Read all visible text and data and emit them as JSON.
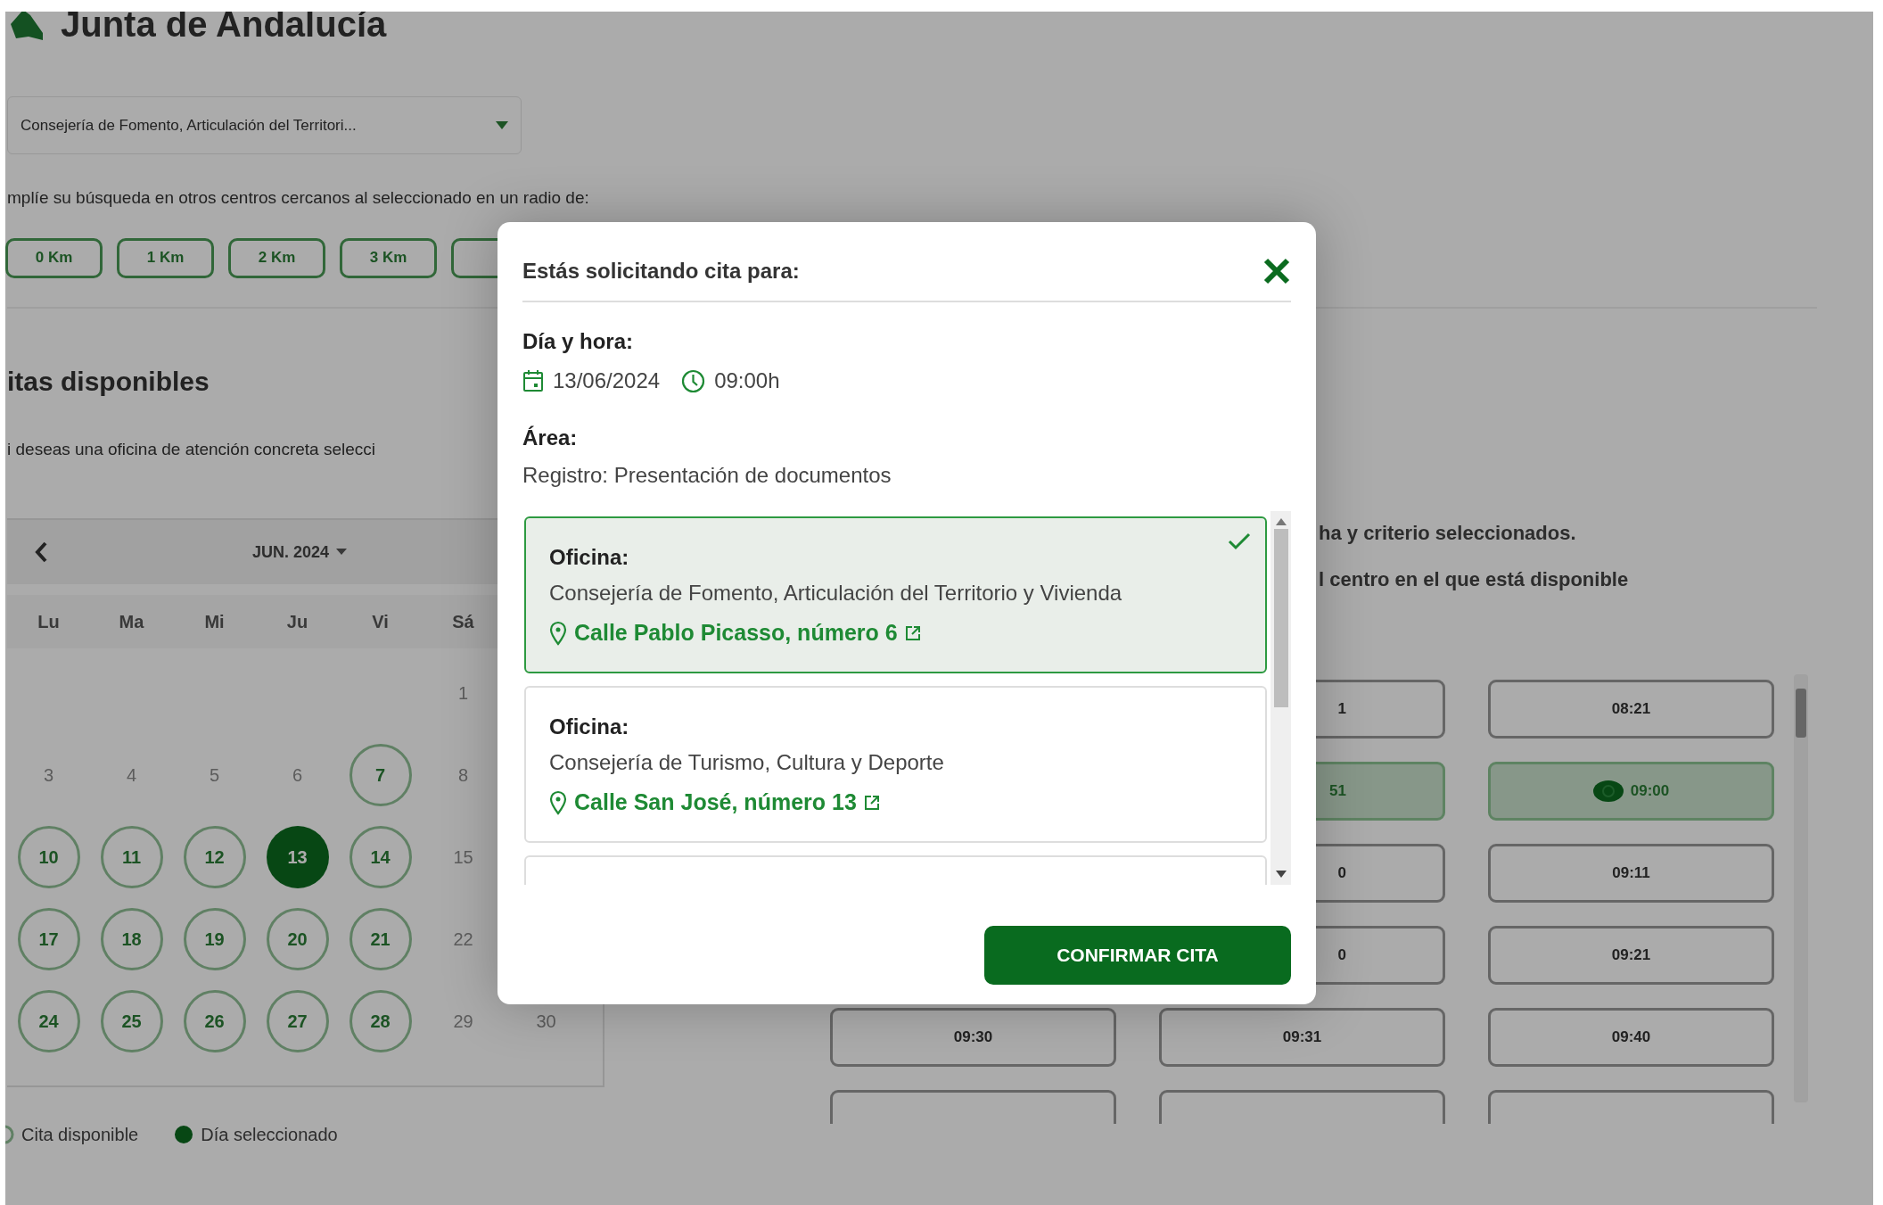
{
  "header": {
    "title": "Junta de Andalucía"
  },
  "office_select": {
    "value": "Consejería de Fomento, Articulación del Territori..."
  },
  "radius_prompt": "mplíe su búsqueda en otros centros cercanos al seleccionado en un radio de:",
  "radius_options": [
    {
      "label": "0 Km",
      "selected": false
    },
    {
      "label": "1 Km",
      "selected": false
    },
    {
      "label": "2 Km",
      "selected": false
    },
    {
      "label": "3 Km",
      "selected": false
    },
    {
      "selected": false
    }
  ],
  "section_title": "itas disponibles",
  "section_hint": "i deseas una oficina de atención concreta selecci",
  "results_notes": [
    "ha y criterio seleccionados.",
    "l centro en el que está disponible"
  ],
  "calendar": {
    "month": "JUN. 2024",
    "weekdays": [
      "Lu",
      "Ma",
      "Mi",
      "Ju",
      "Vi",
      "Sá"
    ],
    "weeks": [
      [
        {
          "day": "1",
          "available": false,
          "selected": false
        }
      ],
      [
        {
          "day": "3",
          "available": false,
          "selected": false
        },
        {
          "day": "4",
          "available": false,
          "selected": false
        },
        {
          "day": "5",
          "available": false,
          "selected": false
        },
        {
          "day": "6",
          "available": false,
          "selected": false
        },
        {
          "day": "7",
          "available": true,
          "selected": false
        },
        {
          "day": "8",
          "available": false,
          "selected": false
        }
      ],
      [
        {
          "day": "10",
          "available": true,
          "selected": false
        },
        {
          "day": "11",
          "available": true,
          "selected": false
        },
        {
          "day": "12",
          "available": true,
          "selected": false
        },
        {
          "day": "13",
          "available": true,
          "selected": true
        },
        {
          "day": "14",
          "available": true,
          "selected": false
        },
        {
          "day": "15",
          "available": false,
          "selected": false
        }
      ],
      [
        {
          "day": "17",
          "available": true,
          "selected": false
        },
        {
          "day": "18",
          "available": true,
          "selected": false
        },
        {
          "day": "19",
          "available": true,
          "selected": false
        },
        {
          "day": "20",
          "available": true,
          "selected": false
        },
        {
          "day": "21",
          "available": true,
          "selected": false
        },
        {
          "day": "22",
          "available": false,
          "selected": false
        }
      ],
      [
        {
          "day": "24",
          "available": true,
          "selected": false
        },
        {
          "day": "25",
          "available": true,
          "selected": false
        },
        {
          "day": "26",
          "available": true,
          "selected": false
        },
        {
          "day": "27",
          "available": true,
          "selected": false
        },
        {
          "day": "28",
          "available": true,
          "selected": false
        },
        {
          "day": "29",
          "available": false,
          "selected": false
        },
        {
          "day": "30",
          "available": false,
          "selected": false
        }
      ]
    ]
  },
  "legend": [
    {
      "label": "Cita disponible",
      "kind": "ring"
    },
    {
      "label": "Día seleccionado",
      "kind": "dot"
    }
  ],
  "time_slots": [
    [
      {
        "time": "1",
        "partial": true,
        "selected": false
      },
      {
        "time": "08:21",
        "selected": false
      }
    ],
    [
      {
        "time": "51",
        "partial": true,
        "selected": true
      },
      {
        "time": "09:00",
        "selected": true
      }
    ],
    [
      {
        "time": "0",
        "partial": true,
        "selected": false
      },
      {
        "time": "09:11",
        "selected": false
      }
    ],
    [
      {
        "time": "0",
        "partial": true,
        "selected": false
      },
      {
        "time": "09:21",
        "selected": false
      }
    ],
    [
      {
        "time": "09:30",
        "selected": false
      },
      {
        "time": "09:31",
        "selected": false
      },
      {
        "time": "09:40",
        "selected": false
      }
    ],
    [
      {
        "selected": false
      },
      {
        "selected": false
      },
      {
        "selected": false
      }
    ]
  ],
  "modal": {
    "title": "Estás solicitando cita para:",
    "datetime_label": "Día y hora:",
    "date": "13/06/2024",
    "time": "09:00h",
    "area_label": "Área:",
    "area": "Registro: Presentación de documentos",
    "offices": [
      {
        "label": "Oficina:",
        "name": "Consejería de Fomento, Articulación del Territorio y Vivienda",
        "address": "Calle Pablo Picasso, número 6",
        "selected": true
      },
      {
        "label": "Oficina:",
        "name": "Consejería de Turismo, Cultura y Deporte",
        "address": "Calle San José, número 13",
        "selected": false
      },
      {
        "selected": false
      }
    ],
    "confirm_button": "CONFIRMAR CITA"
  }
}
